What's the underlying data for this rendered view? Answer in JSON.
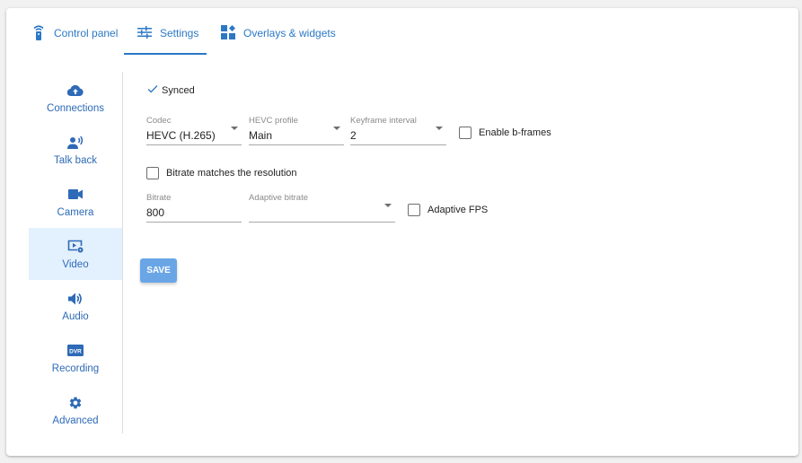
{
  "tabs": [
    {
      "label": "Control panel",
      "icon": "remote-icon",
      "active": false
    },
    {
      "label": "Settings",
      "icon": "tune-icon",
      "active": true
    },
    {
      "label": "Overlays & widgets",
      "icon": "widgets-icon",
      "active": false
    }
  ],
  "sidebar": {
    "items": [
      {
        "label": "Connections",
        "icon": "cloud-upload-icon",
        "active": false
      },
      {
        "label": "Talk back",
        "icon": "talk-back-icon",
        "active": false
      },
      {
        "label": "Camera",
        "icon": "videocam-icon",
        "active": false
      },
      {
        "label": "Video",
        "icon": "video-settings-icon",
        "active": true
      },
      {
        "label": "Audio",
        "icon": "volume-icon",
        "active": false
      },
      {
        "label": "Recording",
        "icon": "dvr-icon",
        "active": false
      },
      {
        "label": "Advanced",
        "icon": "gear-icon",
        "active": false
      }
    ]
  },
  "status": {
    "synced_label": "Synced"
  },
  "form": {
    "codec": {
      "label": "Codec",
      "value": "HEVC (H.265)"
    },
    "hevc_profile": {
      "label": "HEVC profile",
      "value": "Main"
    },
    "keyframe_interval": {
      "label": "Keyframe interval",
      "value": "2"
    },
    "enable_bframes": {
      "label": "Enable b-frames",
      "checked": false
    },
    "bitrate_matches": {
      "label": "Bitrate matches the resolution",
      "checked": false
    },
    "bitrate": {
      "label": "Bitrate",
      "value": "800"
    },
    "adaptive_bitrate": {
      "label": "Adaptive bitrate",
      "value": ""
    },
    "adaptive_fps": {
      "label": "Adaptive FPS",
      "checked": false
    },
    "save_label": "SAVE"
  },
  "colors": {
    "accent": "#2b78c5",
    "active_bg": "#e3f0fd",
    "save_button": "#6aa6e6"
  }
}
